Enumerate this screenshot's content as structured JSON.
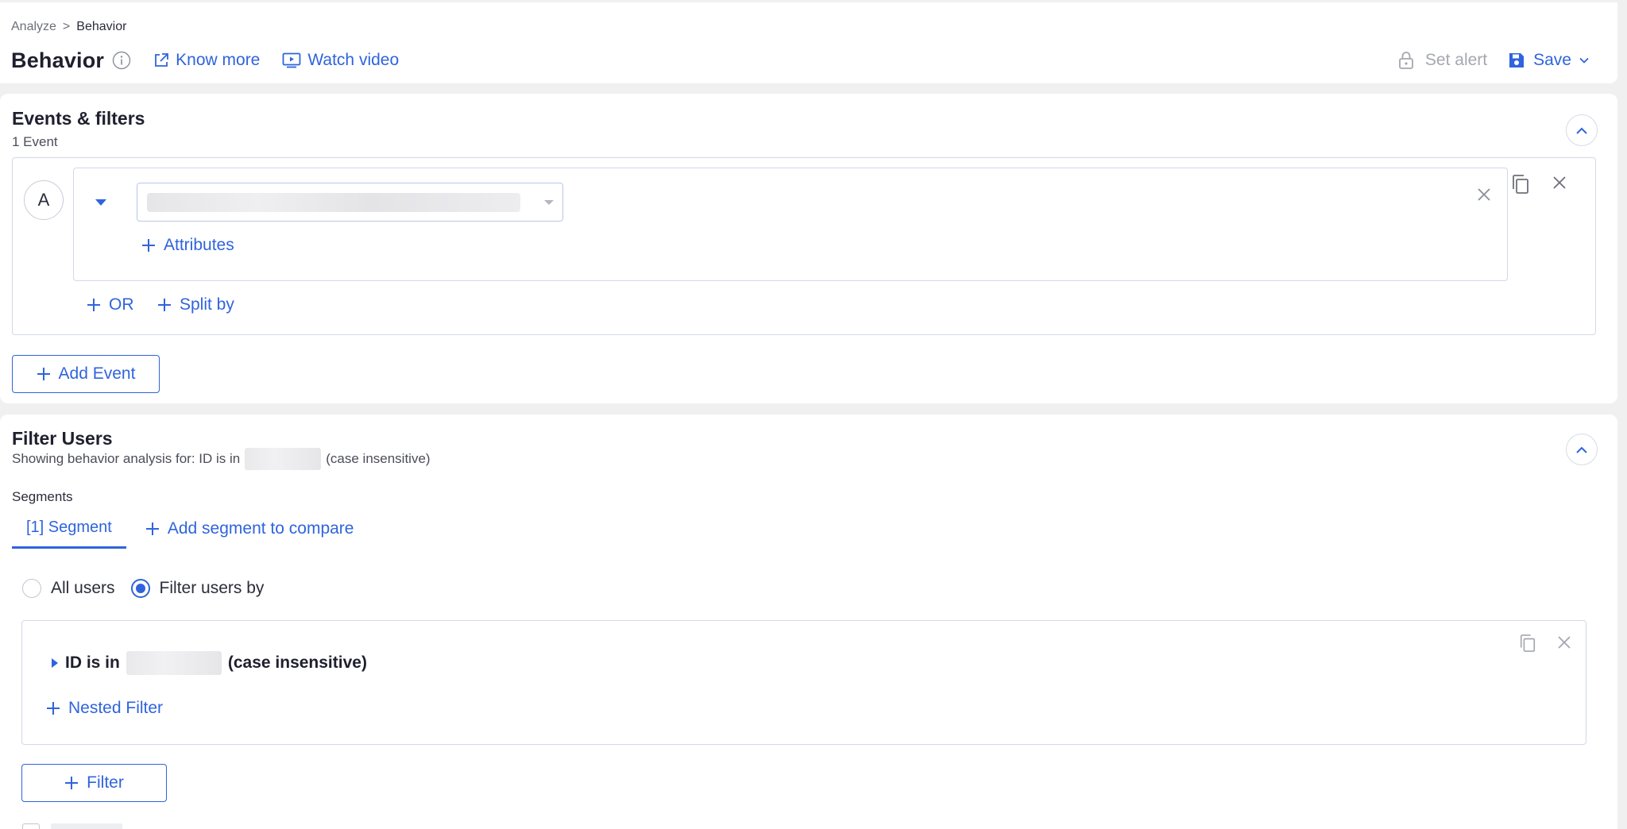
{
  "breadcrumb": {
    "parent": "Analyze",
    "separator": ">",
    "current": "Behavior"
  },
  "header": {
    "title": "Behavior",
    "know_more": "Know more",
    "watch_video": "Watch video",
    "set_alert": "Set alert",
    "save": "Save"
  },
  "events": {
    "title": "Events & filters",
    "count": "1 Event",
    "badge": "A",
    "attributes": "Attributes",
    "or": "OR",
    "split_by": "Split by",
    "add_event": "Add Event"
  },
  "filter_users": {
    "title": "Filter Users",
    "summary_prefix": "Showing behavior analysis for: ID  is in",
    "summary_suffix": "(case insensitive)",
    "segments_label": "Segments",
    "segment_tab": "[1] Segment",
    "add_segment": "Add segment to compare",
    "radio_all": "All users",
    "radio_filter": "Filter users by",
    "selected_radio": "Filter users by",
    "filter_expr_prefix": "ID  is in",
    "filter_expr_suffix": "(case insensitive)",
    "nested_filter": "Nested Filter",
    "filter_button": "Filter"
  },
  "colors": {
    "accent": "#2f64dc",
    "muted": "#a5a7b0",
    "background": "#f0f0f0"
  }
}
